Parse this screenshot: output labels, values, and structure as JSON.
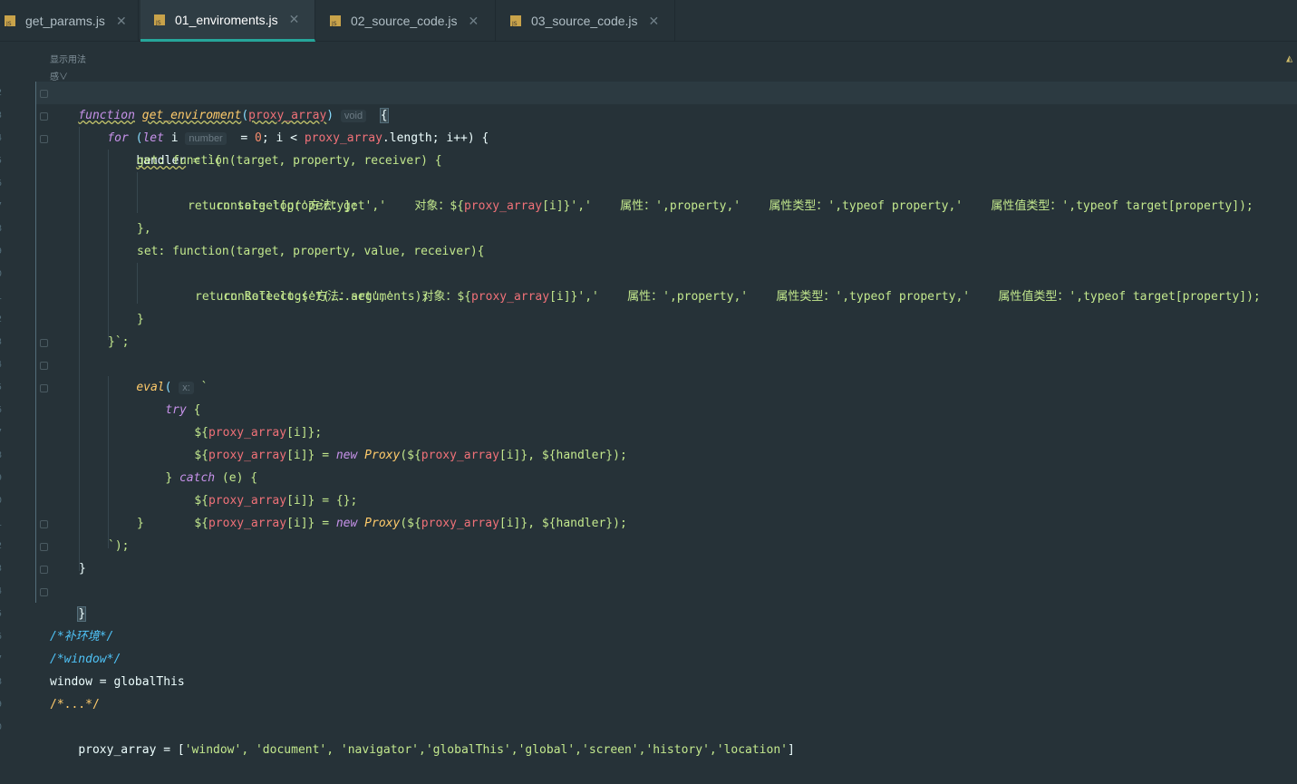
{
  "tabs": [
    {
      "label": "get_params.js",
      "active": false
    },
    {
      "label": "01_enviroments.js",
      "active": true
    },
    {
      "label": "02_source_code.js",
      "active": false
    },
    {
      "label": "03_source_code.js",
      "active": false
    }
  ],
  "editor": {
    "usage_hint": "显示用法",
    "usage_hint2": "感∨",
    "line_numbers": [
      "2",
      "3",
      "4",
      "5",
      "6",
      "7",
      "8",
      "9",
      "0",
      "1",
      "2",
      "3",
      "4",
      "5",
      "6",
      "7",
      "8",
      "9",
      "0",
      "1",
      "2",
      "3",
      "4",
      "5",
      "6",
      "7",
      "8",
      "9",
      "0"
    ],
    "inlay_void": "void",
    "inlay_number": "number",
    "inlay_x": "x:",
    "lines": {
      "l1_kw": "function",
      "l1_fn": "get_enviroment",
      "l1_p1": "(",
      "l1_param": "proxy_array",
      "l1_p2": ")",
      "l1_brace": "{",
      "l2_kw": "for",
      "l2_a": "(",
      "l2_let": "let",
      "l2_i": " i ",
      "l2_eq": "= ",
      "l2_num": "0",
      "l2_b": "; i < ",
      "l2_param": "proxy_array",
      "l2_c": ".length; i++) {",
      "l3_a": "handler",
      "l3_b": " = `{",
      "l4": "get: function(target, property, receiver) {",
      "l5_a": "console.log('方法：get','    对象：${",
      "l5_param": "proxy_array",
      "l5_b": "[i]}','    属性：',property,'    属性类型：',typeof property,'    属性值类型：',typeof target[property]);",
      "l6": "return target[property];",
      "l7": "},",
      "l8": "set: function(target, property, value, receiver){",
      "l9_a": "console.log('方法：set','    对象：${",
      "l9_param": "proxy_array",
      "l9_b": "[i]}','    属性：',property,'    属性类型：',typeof property,'    属性值类型：',typeof target[property]);",
      "l10": "return Reflect.set(...arguments);",
      "l11": "}",
      "l12": "}`;",
      "l13_fn": "eval",
      "l13_a": "(",
      "l13_b": " `",
      "l14_kw": "try",
      "l14_b": " {",
      "l15_a": "${",
      "l15_param": "proxy_array",
      "l15_b": "[i]};",
      "l16_a": "${",
      "l16_param": "proxy_array",
      "l16_b": "[i]} = ",
      "l16_new": "new",
      "l16_proxy": "Proxy",
      "l16_c": "(${",
      "l16_param2": "proxy_array",
      "l16_d": "[i]}, ${handler});",
      "l17_a": "} ",
      "l17_kw": "catch",
      "l17_b": " (e) {",
      "l18_a": "${",
      "l18_param": "proxy_array",
      "l18_b": "[i]} = {};",
      "l19_a": "${",
      "l19_param": "proxy_array",
      "l19_b": "[i]} = ",
      "l19_new": "new",
      "l19_proxy": "Proxy",
      "l19_c": "(${",
      "l19_param2": "proxy_array",
      "l19_d": "[i]}, ${handler});",
      "l20": "}",
      "l21": "`);",
      "l22": "}",
      "l23": "}",
      "l25": "/*补环境*/",
      "l26": "/*window*/",
      "l27": "window = globalThis",
      "l28": "/*...*/",
      "l29_a": "proxy_array = [",
      "l29_b": "'window', 'document', 'navigator','globalThis','global','screen','history','location'",
      "l29_c": "]"
    }
  }
}
